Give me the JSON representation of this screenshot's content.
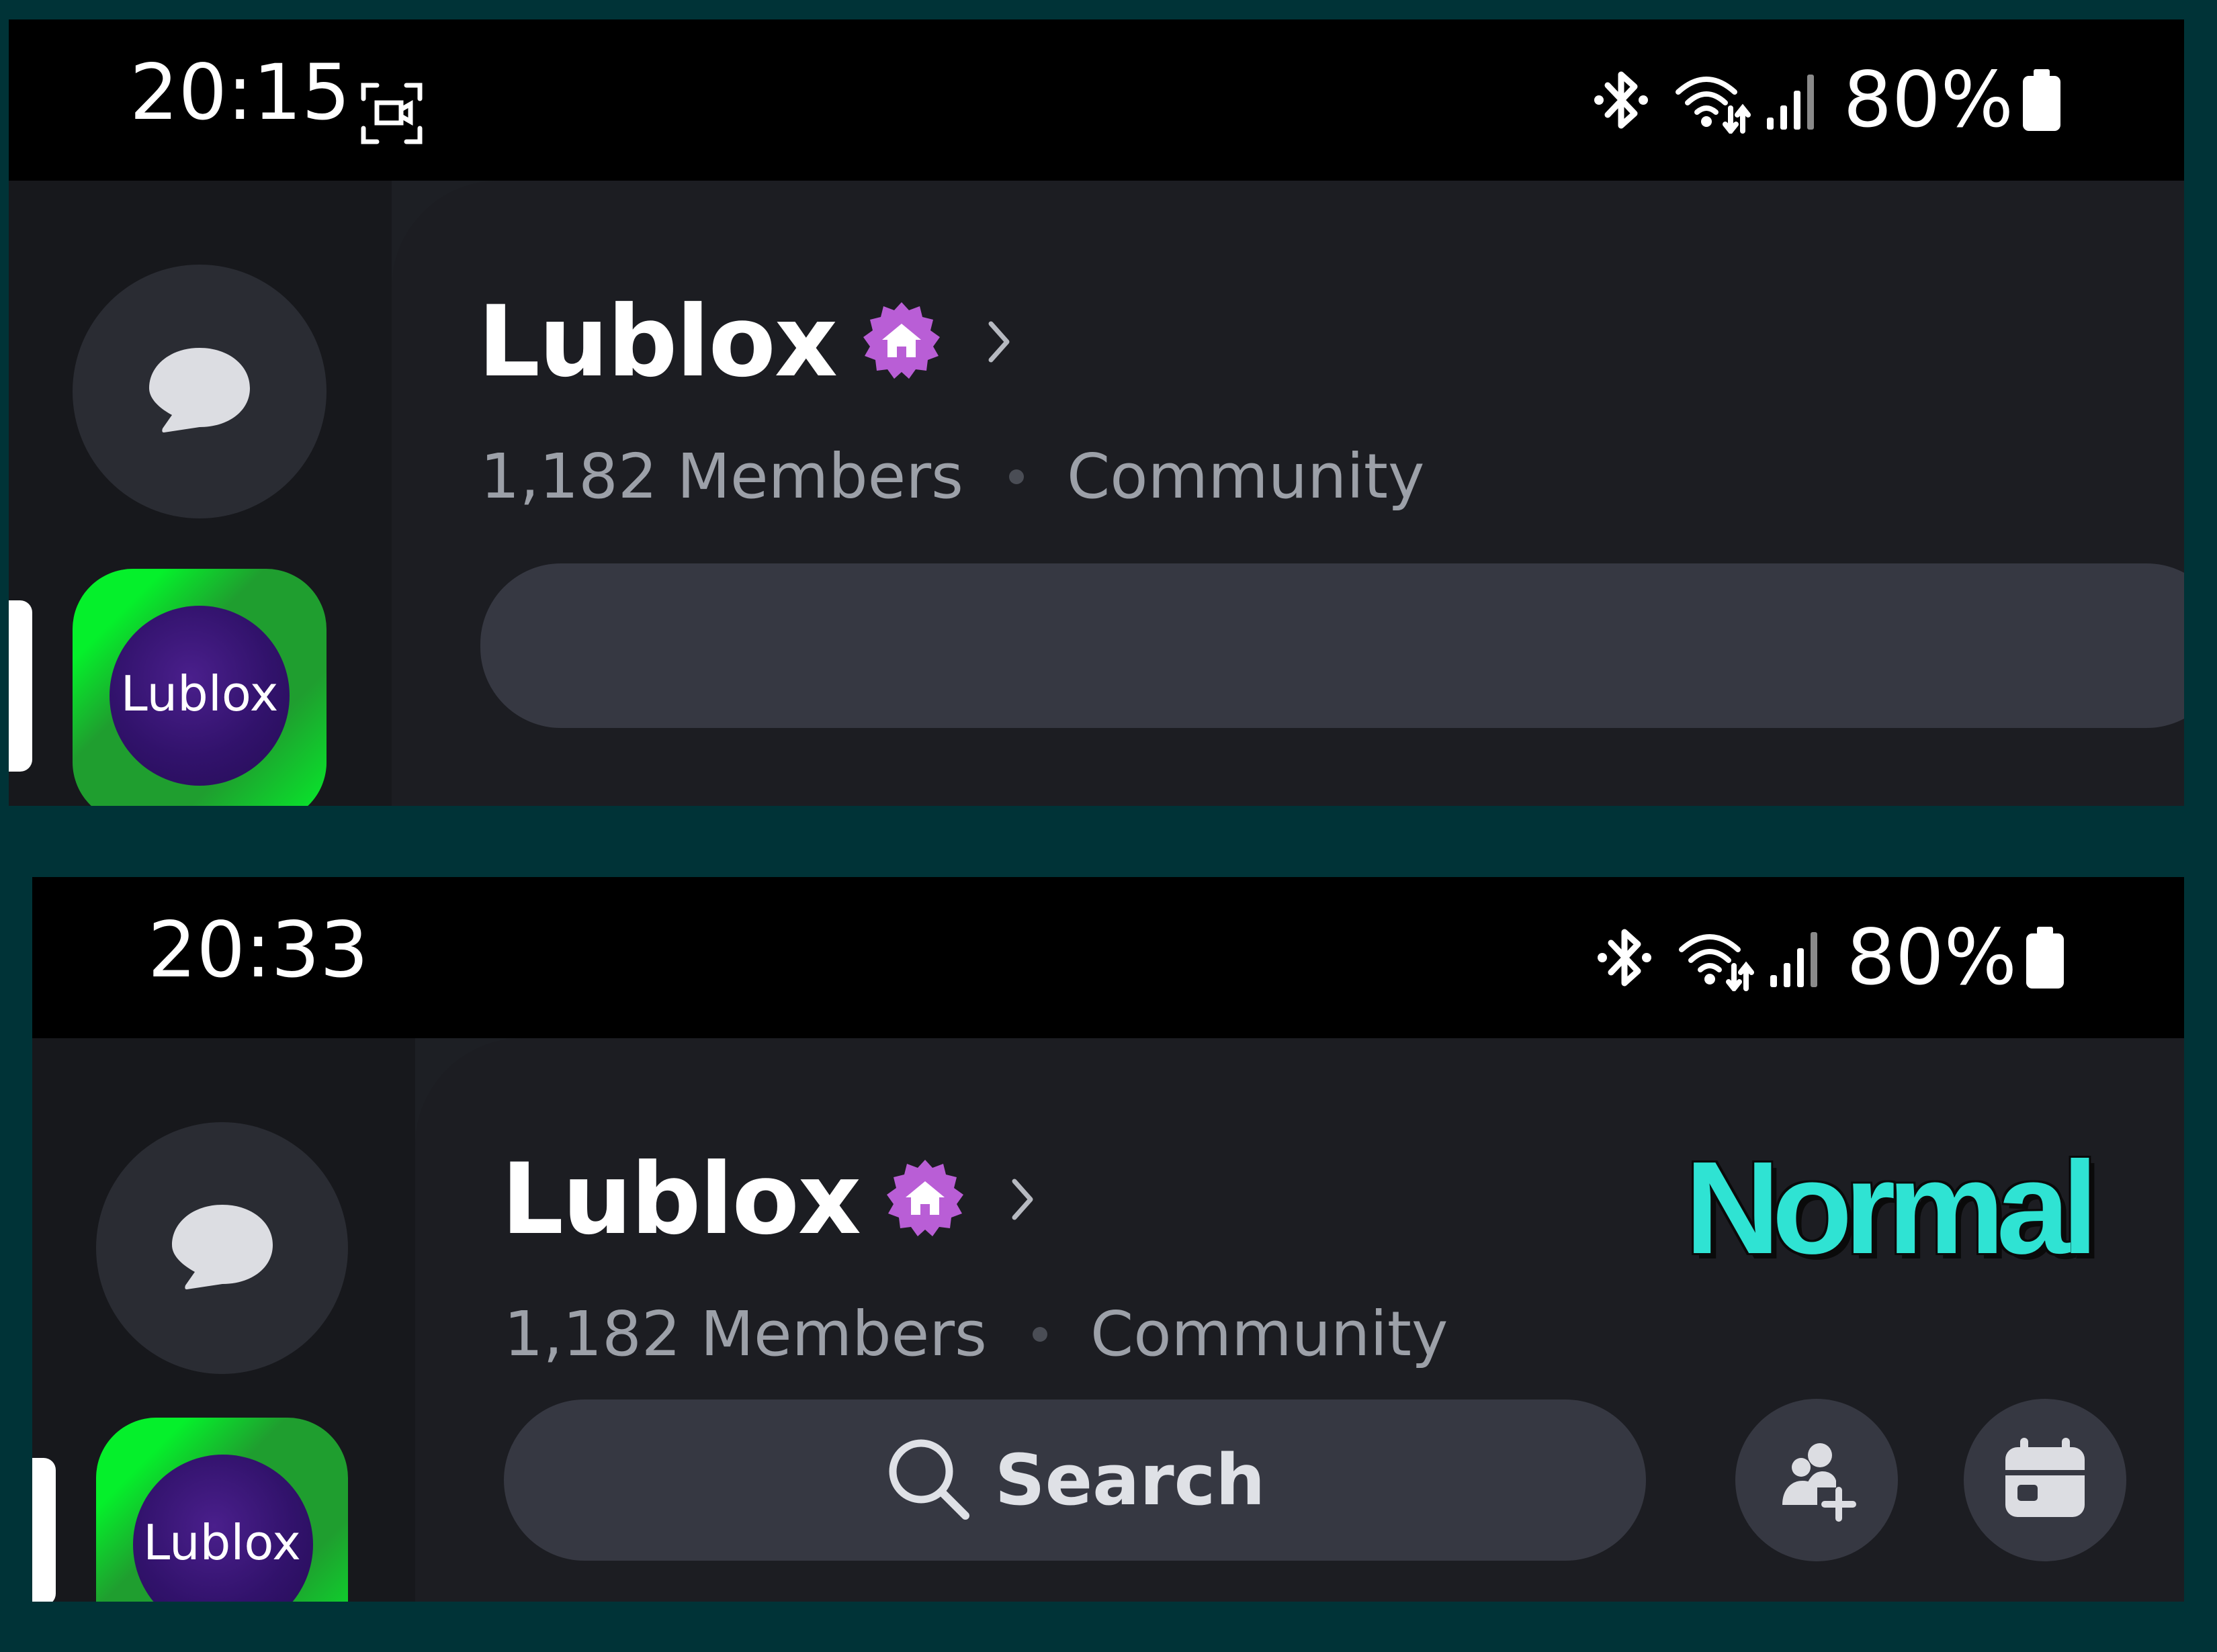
{
  "screenshots": [
    {
      "status_bar": {
        "time": "20:15",
        "battery": "80%",
        "icons": [
          "screenshot-frame-icon",
          "bluetooth-icon",
          "wifi-icon",
          "signal-icon",
          "battery-icon"
        ]
      },
      "server": {
        "name": "Lublox",
        "badge_icon": "community-home-badge-icon",
        "members": "1,182 Members",
        "type": "Community",
        "icon_label": "Lublox"
      },
      "search": {
        "label": ""
      }
    },
    {
      "status_bar": {
        "time": "20:33",
        "battery": "80%",
        "icons": [
          "bluetooth-icon",
          "wifi-icon",
          "signal-icon",
          "battery-icon"
        ]
      },
      "server": {
        "name": "Lublox",
        "badge_icon": "community-home-badge-icon",
        "members": "1,182 Members",
        "type": "Community",
        "icon_label": "Lublox"
      },
      "search": {
        "label": "Search"
      },
      "actions": [
        "invite-members-icon",
        "events-calendar-icon"
      ],
      "overlay_label": "Normal"
    }
  ],
  "colors": {
    "background": "#003337",
    "overlay_text": "#2fe3d3",
    "badge": "#b95ed6",
    "server_icon_green": "#1f9e2f",
    "server_icon_purple": "#31126b"
  }
}
